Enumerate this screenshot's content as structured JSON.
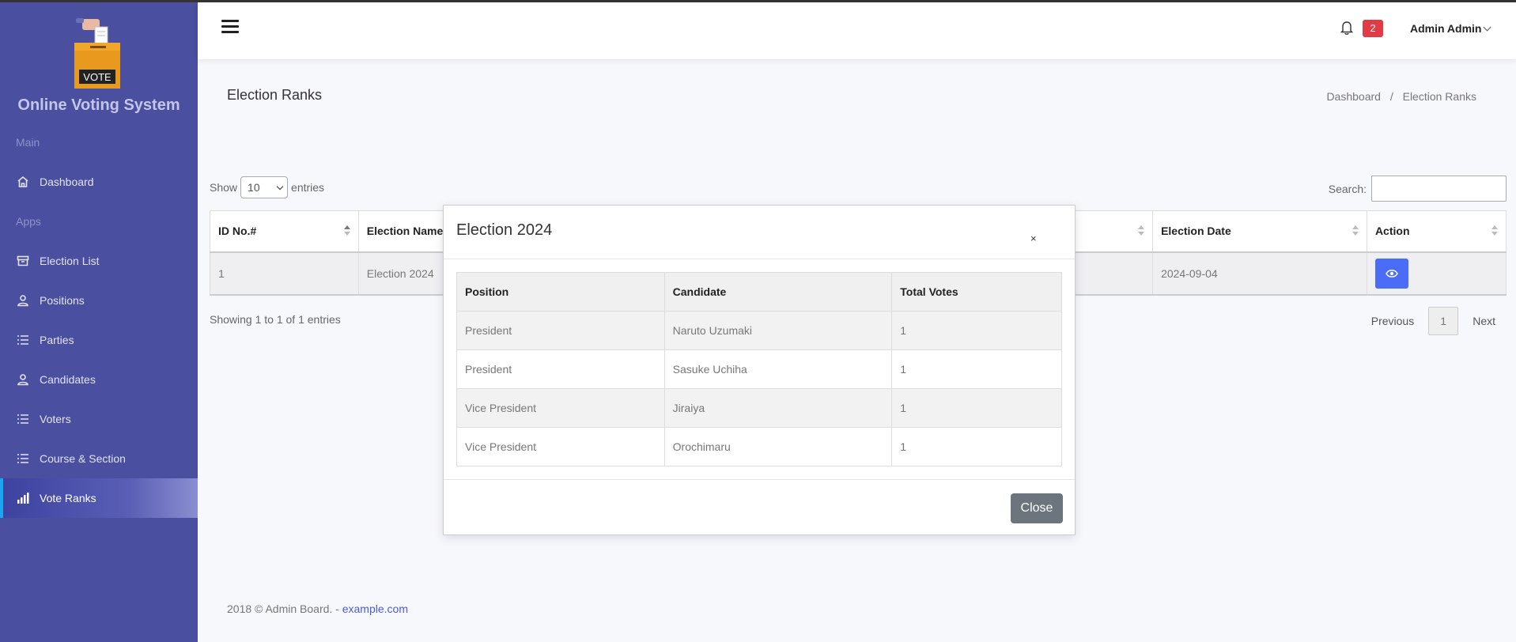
{
  "sidebar": {
    "brand_title": "Online Voting System",
    "logo_text": "VOTE",
    "sections": [
      {
        "header": "Main",
        "items": [
          {
            "label": "Dashboard",
            "icon": "home-icon"
          }
        ]
      },
      {
        "header": "Apps",
        "items": [
          {
            "label": "Election List",
            "icon": "archive-icon"
          },
          {
            "label": "Positions",
            "icon": "user-icon"
          },
          {
            "label": "Parties",
            "icon": "list-icon"
          },
          {
            "label": "Candidates",
            "icon": "user-icon"
          },
          {
            "label": "Voters",
            "icon": "list-icon"
          },
          {
            "label": "Course & Section",
            "icon": "list-icon"
          },
          {
            "label": "Vote Ranks",
            "icon": "bar-chart-icon",
            "active": true
          }
        ]
      }
    ]
  },
  "header": {
    "notification_count": "2",
    "user_name": "Admin Admin"
  },
  "page": {
    "title": "Election Ranks",
    "breadcrumb": [
      "Dashboard",
      "Election Ranks"
    ],
    "breadcrumb_sep": "/"
  },
  "table_controls": {
    "show_label": "Show",
    "entries_value": "10",
    "entries_label": "entries",
    "search_label": "Search:"
  },
  "datatable": {
    "columns": [
      "ID No.#",
      "Election Name",
      "",
      "Election Date",
      "Action"
    ],
    "rows": [
      {
        "id": "1",
        "name": "Election 2024",
        "date": "2024-09-04"
      }
    ]
  },
  "pagination": {
    "info": "Showing 1 to 1 of 1 entries",
    "previous": "Previous",
    "current": "1",
    "next": "Next"
  },
  "footer": {
    "text": "2018 © Admin Board. - ",
    "link": "example.com"
  },
  "modal": {
    "title": "Election 2024",
    "close_x": "×",
    "columns": [
      "Position",
      "Candidate",
      "Total Votes"
    ],
    "rows": [
      {
        "position": "President",
        "candidate": "Naruto Uzumaki",
        "votes": "1"
      },
      {
        "position": "President",
        "candidate": "Sasuke Uchiha",
        "votes": "1"
      },
      {
        "position": "Vice President",
        "candidate": "Jiraiya",
        "votes": "1"
      },
      {
        "position": "Vice President",
        "candidate": "Orochimaru",
        "votes": "1"
      }
    ],
    "close_label": "Close"
  },
  "colors": {
    "sidebar_bg": "#4a4f9f",
    "accent_blue": "#4a6cf7",
    "badge_red": "#e23b45"
  }
}
